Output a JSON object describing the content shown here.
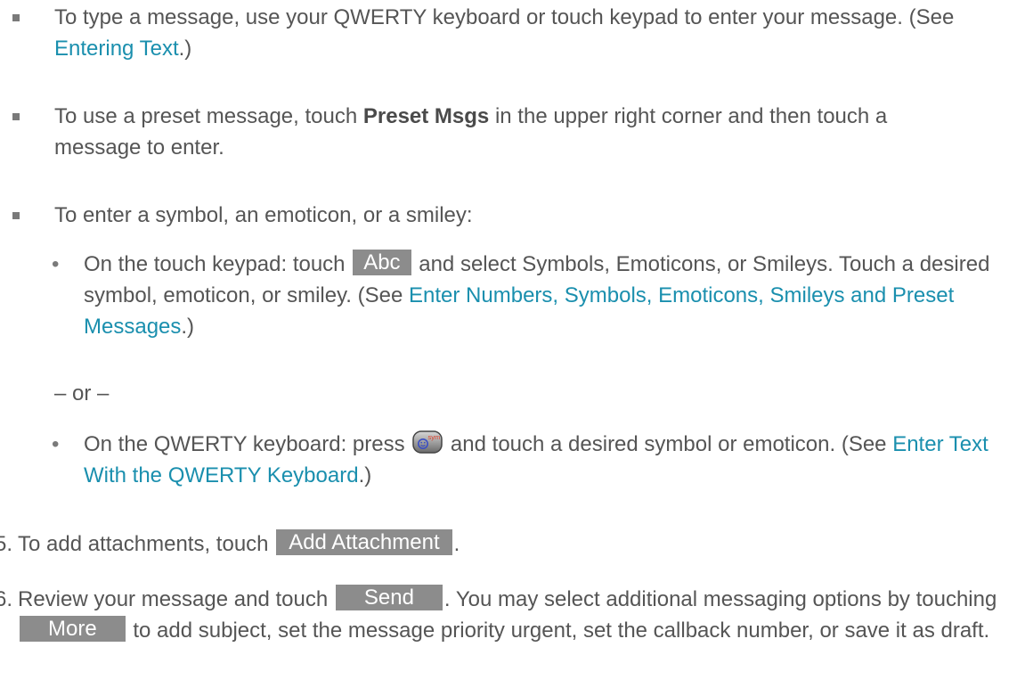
{
  "bullets": {
    "type_message": {
      "text_before": "To type a message, use your QWERTY keyboard or touch keypad to enter your message. (See ",
      "link": "Entering Text",
      "text_after": ".)"
    },
    "preset_message": {
      "text_before": "To use a preset message, touch ",
      "bold": "Preset Msgs",
      "text_after": " in the upper right corner and then touch a message to enter."
    },
    "symbol": {
      "text": "To enter a symbol, an emoticon, or a smiley:"
    }
  },
  "sub_bullets": {
    "touch_keypad": {
      "text_before": "On the touch keypad: touch ",
      "key": "Abc",
      "text_middle": " and select Symbols, Emoticons, or Smileys. Touch a desired symbol, emoticon, or smiley. (See ",
      "link": "Enter Numbers, Symbols, Emoticons, Smileys and Preset Messages",
      "text_after": ".)"
    },
    "or_separator": "– or –",
    "qwerty": {
      "text_before": "On the QWERTY keyboard: press ",
      "icon_label": "sym",
      "text_middle": " and touch a desired symbol or emoticon. (See ",
      "link": "Enter Text With the QWERTY Keyboard",
      "text_after": ".)"
    }
  },
  "steps": {
    "step5": {
      "number": "5.",
      "text_before": "To add attachments, touch ",
      "key": "Add Attachment",
      "text_after": "."
    },
    "step6": {
      "number": "6.",
      "text_before": "Review your message and touch ",
      "send_key": "Send",
      "text_middle": ". You may select additional messaging options by touching ",
      "more_key": "More",
      "text_after": " to add subject, set the message priority urgent, set the callback number, or save it as draft."
    }
  },
  "colors": {
    "body_text": "#555555",
    "link": "#1a8fae",
    "key_background": "#8c8c8c",
    "key_text": "#ffffff",
    "bullet": "#7a7a7a",
    "sym_icon_red": "#e0402a",
    "sym_icon_blue": "#3b4fc4"
  },
  "icons": {
    "bullet_level1": "square-bullet-icon",
    "bullet_level2": "round-bullet-icon",
    "symbol_key": "sym-smiley-key-icon"
  }
}
